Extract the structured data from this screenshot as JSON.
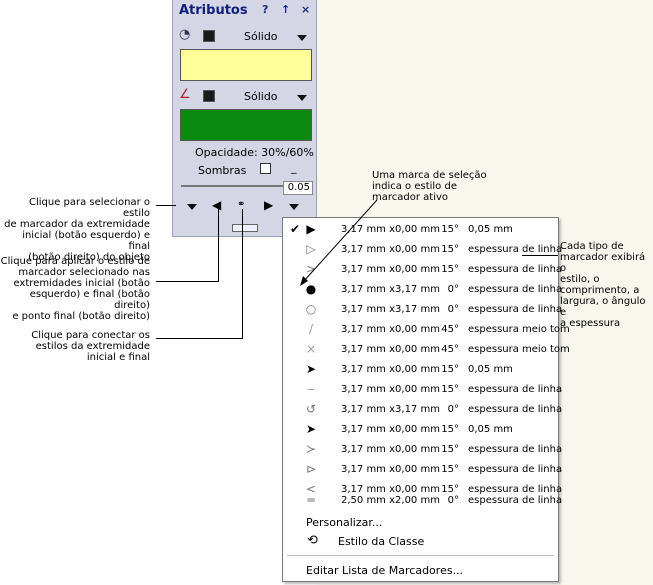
{
  "palette": {
    "title": "Atributos",
    "title_buttons": [
      "?",
      "↑",
      "×"
    ],
    "fill_style": "Sólido",
    "line_style": "Sólido",
    "fill_color": "#ffff99",
    "line_color": "#0a8a10",
    "opacity": "Opacidade: 30%/60%",
    "shadows": "Sombras",
    "thickness": "0.05"
  },
  "menu": {
    "items": [
      {
        "check": "✔",
        "marker": "▶",
        "dim": "3,17 mm x0,00 mm",
        "angle": "15°",
        "width": "0,05 mm"
      },
      {
        "check": "",
        "marker": "▷",
        "dim": "3,17 mm x0,00 mm",
        "angle": "15°",
        "width": "espessura de linha"
      },
      {
        "check": "",
        "marker": ">",
        "dim": "3,17 mm x0,00 mm",
        "angle": "15°",
        "width": "espessura de linha"
      },
      {
        "check": "",
        "marker": "●",
        "dim": "3,17 mm x3,17 mm",
        "angle": "0°",
        "width": "espessura de linha"
      },
      {
        "check": "",
        "marker": "○",
        "dim": "3,17 mm x3,17 mm",
        "angle": "0°",
        "width": "espessura de linha"
      },
      {
        "check": "",
        "marker": "/",
        "dim": "3,17 mm x0,00 mm",
        "angle": "45°",
        "width": "espessura meio tom"
      },
      {
        "check": "",
        "marker": "×",
        "dim": "3,17 mm x0,00 mm",
        "angle": "45°",
        "width": "espessura meio tom"
      },
      {
        "check": "",
        "marker": "➤",
        "dim": "3,17 mm x0,00 mm",
        "angle": "15°",
        "width": "0,05 mm"
      },
      {
        "check": "",
        "marker": "‒",
        "dim": "3,17 mm x0,00 mm",
        "angle": "15°",
        "width": "espessura de linha"
      },
      {
        "check": "",
        "marker": "↺",
        "dim": "3,17 mm x3,17 mm",
        "angle": "0°",
        "width": "espessura de linha"
      },
      {
        "check": "",
        "marker": "➤",
        "dim": "3,17 mm x0,00 mm",
        "angle": "15°",
        "width": "0,05 mm"
      },
      {
        "check": "",
        "marker": "≻",
        "dim": "3,17 mm x0,00 mm",
        "angle": "15°",
        "width": "espessura de linha"
      },
      {
        "check": "",
        "marker": "⊳",
        "dim": "3,17 mm x0,00 mm",
        "angle": "15°",
        "width": "espessura de linha"
      },
      {
        "check": "",
        "marker": "<",
        "dim": "3,17 mm x0,00 mm",
        "angle": "15°",
        "width": "espessura de linha"
      },
      {
        "check": "",
        "marker": "═",
        "dim": "2,50 mm x2,00 mm",
        "angle": "0°",
        "width": "espessura de linha"
      }
    ],
    "customize": "Personalizar...",
    "class_style": "Estilo da Classe",
    "edit_list": "Editar Lista de Marcadores..."
  },
  "callouts": {
    "select_marker": "Clique para selecionar o estilo\nde marcador da extremidade\ninicial (botão esquerdo) e final\n(botão direito) do objeto",
    "apply_marker": "Clique para aplicar o estilo de\nmarcador selecionado nas\nextremidades inicial (botão\nesquerdo) e final (botão\ndireito)\ne ponto final (botão direito)",
    "connect_styles": "Clique para conectar os\nestilos da extremidade\ninicial e final",
    "selection_mark": "Uma marca de seleção\nindica o estilo de\nmarcador ativo",
    "marker_types": "Cada tipo de\nmarcador exibirá o\nestilo, o\ncomprimento, a\nlargura, o ângulo e\na espessura"
  }
}
